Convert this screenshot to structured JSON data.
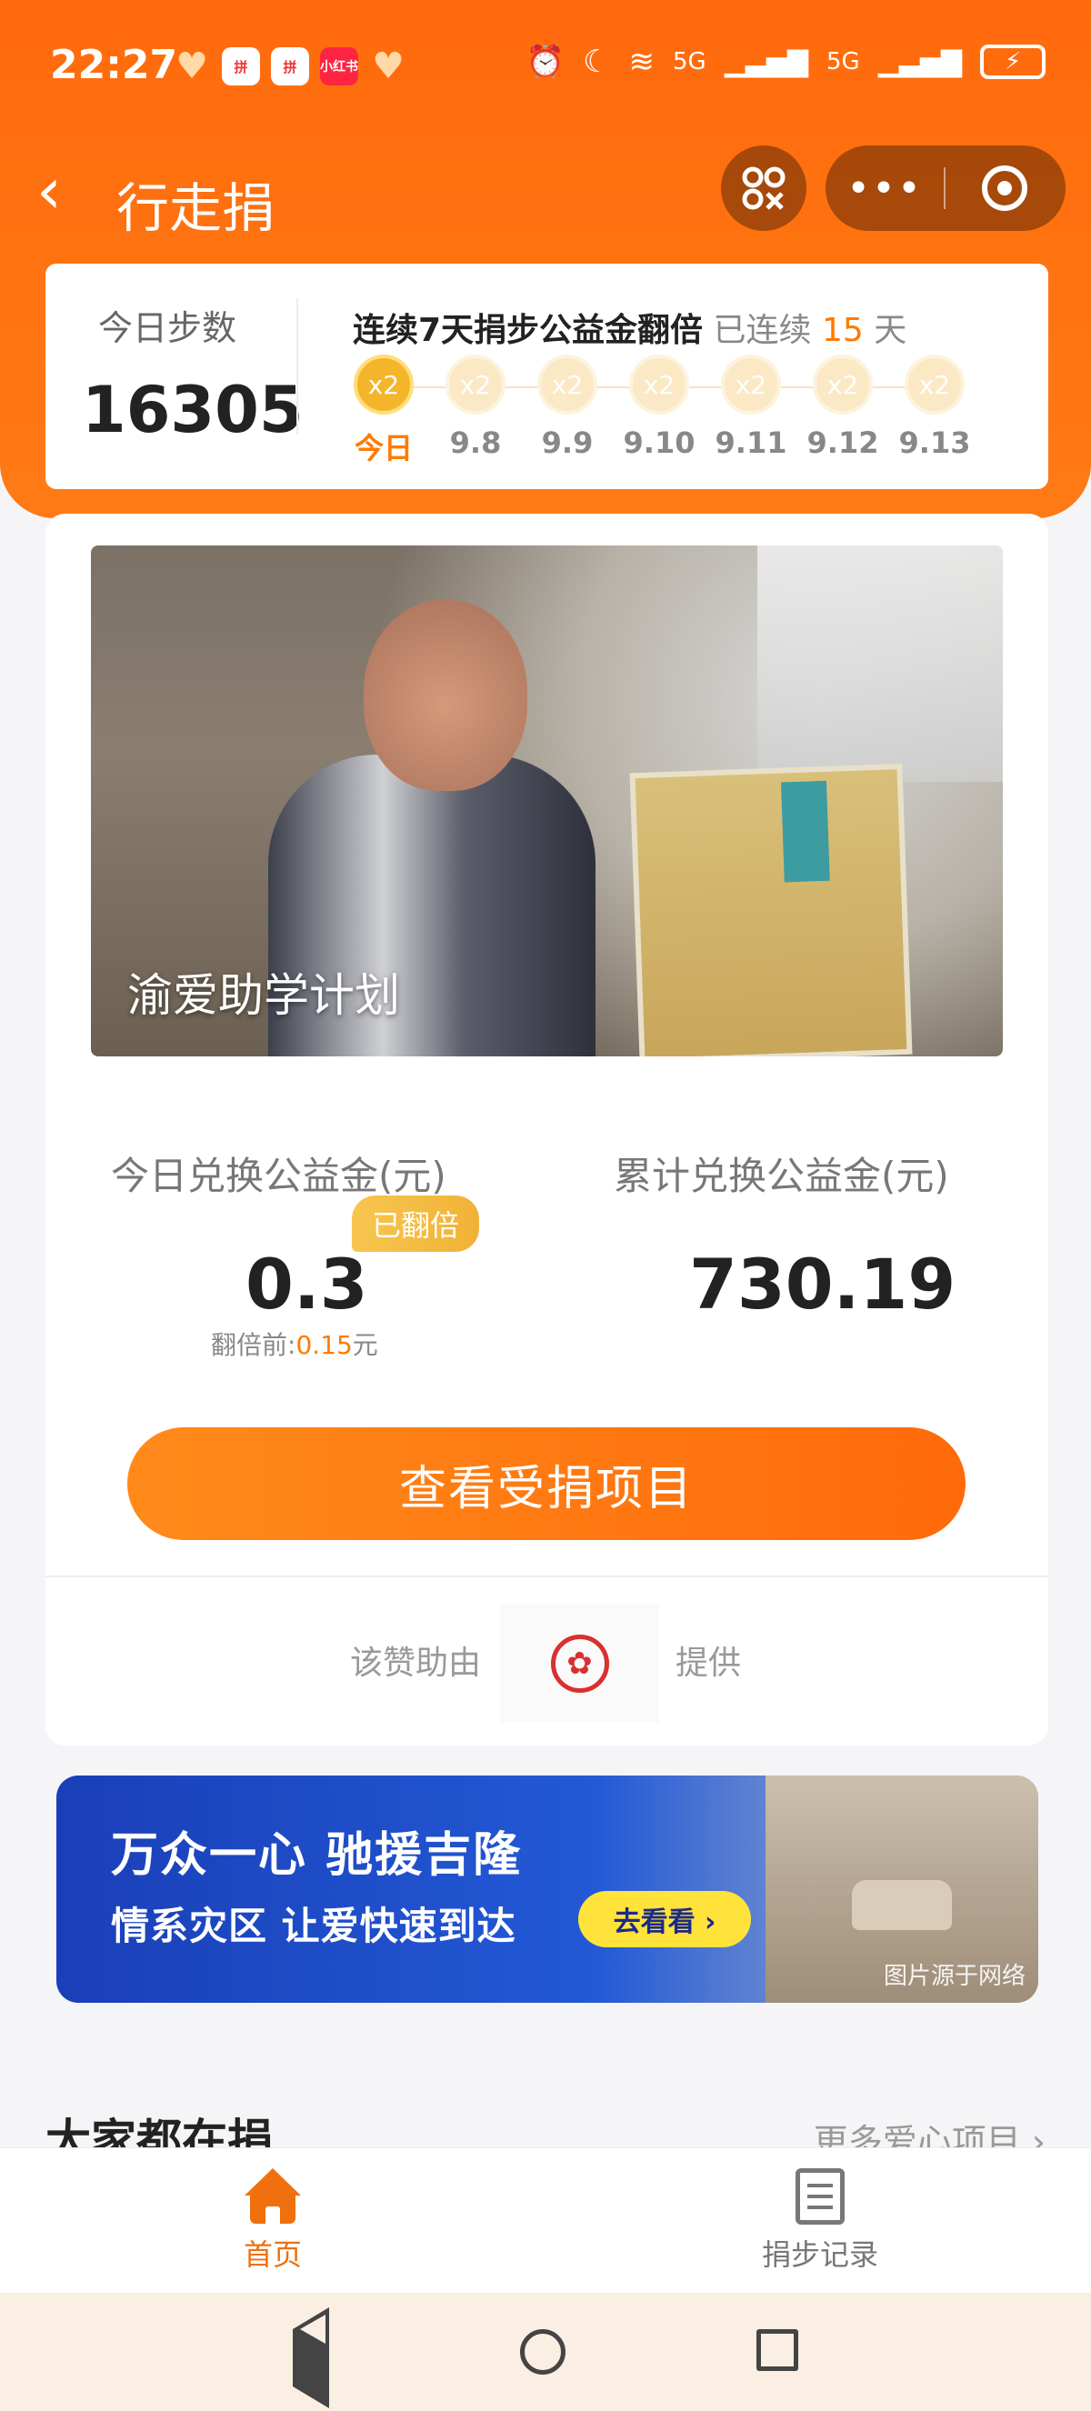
{
  "status_bar": {
    "time": "22:27",
    "apps": [
      "heart-app",
      "pinduoduo",
      "pinduoduo",
      "小红书",
      "heart-app"
    ],
    "network": "5G",
    "network2": "5G"
  },
  "nav": {
    "title": "行走捐",
    "back_icon": "chevron-left",
    "more_icon": "•••"
  },
  "steps": {
    "label": "今日步数",
    "count": "16305",
    "streak_title": "连续7天捐步公益金翻倍",
    "streak_prefix": "已连续",
    "streak_days": "15",
    "streak_unit": "天",
    "days": [
      {
        "badge": "x2",
        "label": "今日",
        "active": true
      },
      {
        "badge": "x2",
        "label": "9.8"
      },
      {
        "badge": "x2",
        "label": "9.9"
      },
      {
        "badge": "x2",
        "label": "9.10"
      },
      {
        "badge": "x2",
        "label": "9.11"
      },
      {
        "badge": "x2",
        "label": "9.12"
      },
      {
        "badge": "x2",
        "label": "9.13"
      }
    ]
  },
  "project": {
    "caption": "渝爱助学计划"
  },
  "stats": {
    "today_label": "今日兑换公益金(元)",
    "today_value": "0.3",
    "doubled_badge": "已翻倍",
    "before_prefix": "翻倍前:",
    "before_value": "0.15",
    "before_unit": "元",
    "total_label": "累计兑换公益金(元)",
    "total_value": "730.19"
  },
  "cta": {
    "label": "查看受捐项目"
  },
  "sponsor": {
    "prefix": "该赞助由",
    "suffix": "提供"
  },
  "banner": {
    "line1": "万众一心 驰援吉隆",
    "line2": "情系灾区 让爱快速到达",
    "button": "去看看 ›",
    "source": "图片源于网络"
  },
  "list": {
    "title": "大家都在捐",
    "more": "更多爱心项目 ›"
  },
  "tabbar": {
    "home": "首页",
    "records": "捐步记录",
    "active_color": "#f07010",
    "inactive_color": "#777777"
  },
  "colors": {
    "brand_orange": "#ff6a0d",
    "accent": "#ff7a00"
  }
}
